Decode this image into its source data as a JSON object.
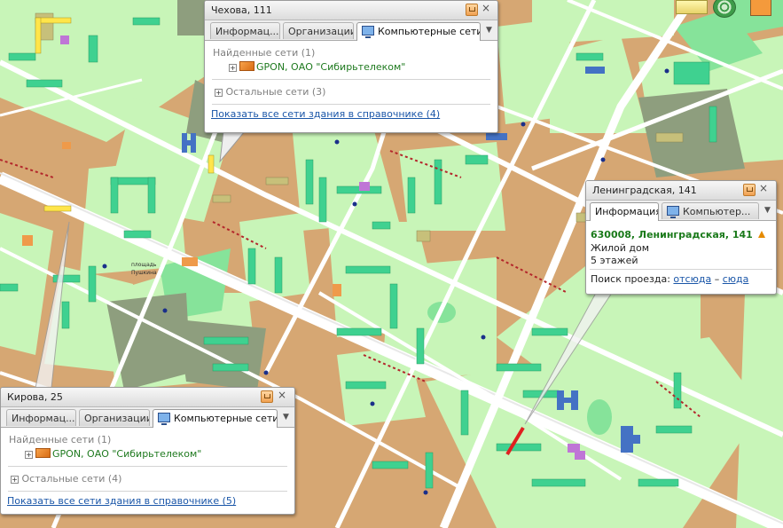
{
  "popups": {
    "chekhova": {
      "title": "Чехова, 111",
      "tabs": [
        "Информац...",
        "Организации",
        "Компьютерные сети"
      ],
      "found_label": "Найденные сети (1)",
      "network_name": "GPON, ОАО \"Сибирьтелеком\"",
      "other_label": "Остальные сети (3)",
      "show_all_link": "Показать все сети здания в справочнике (4)"
    },
    "kirova": {
      "title": "Кирова, 25",
      "tabs": [
        "Информац...",
        "Организации",
        "Компьютерные сети"
      ],
      "found_label": "Найденные сети (1)",
      "network_name": "GPON, ОАО \"Сибирьтелеком\"",
      "other_label": "Остальные сети (4)",
      "show_all_link": "Показать все сети здания в справочнике (5)"
    },
    "leningradskaya": {
      "title": "Ленинградская, 141",
      "tabs": [
        "Информация",
        "Компьютер..."
      ],
      "address": "630008, Ленинградская, 141",
      "type": "Жилой дом",
      "floors": "5 этажей",
      "route_label": "Поиск проезда:",
      "route_from": "отсюда",
      "route_dash": "–",
      "route_to": "сюда"
    }
  },
  "map": {
    "square_label_1": "площадь",
    "square_label_2": "Пушкина"
  },
  "icons": {
    "pin": "pin-icon",
    "close": "close-icon",
    "network_tab": "computer-network-icon",
    "gpon": "gpon-network-icon",
    "expand": "plus-expand-icon",
    "warning": "warning-icon",
    "tab_menu": "chevron-down-icon"
  },
  "colors": {
    "block": "#d6a773",
    "yard": "#c5f5b5",
    "park": "#8de79a",
    "residential": "#44d08a",
    "road": "#ffffff",
    "network_green": "#1f7a1f",
    "link_blue": "#1a56a8"
  }
}
